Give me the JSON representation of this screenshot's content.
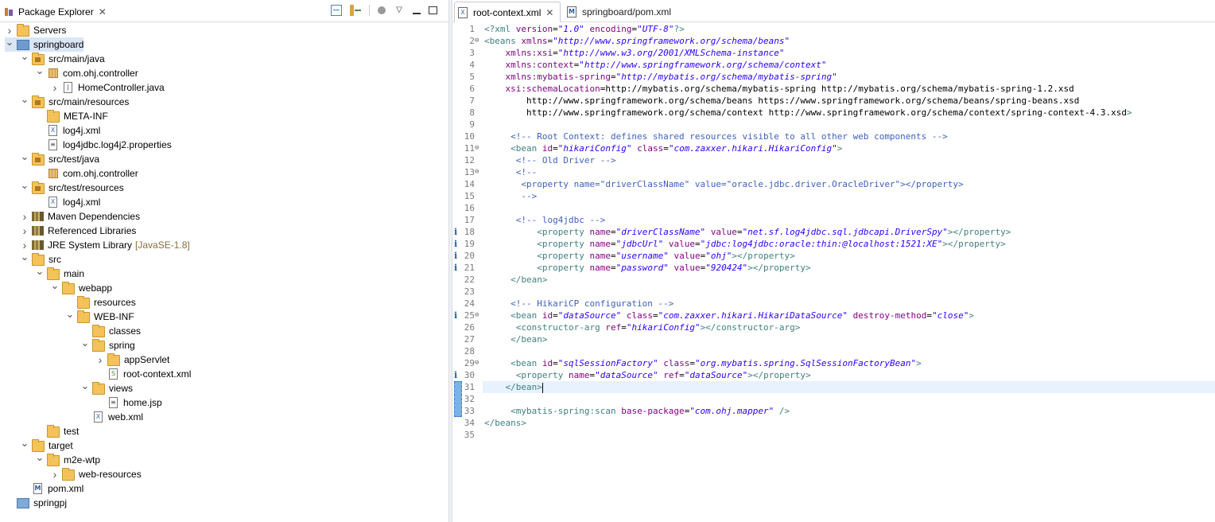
{
  "left_tab": {
    "title": "Package Explorer",
    "close": "✕"
  },
  "editor_tabs": [
    {
      "label": "root-context.xml",
      "close": "✕",
      "active": true
    },
    {
      "label": "springboard/pom.xml",
      "active": false
    }
  ],
  "tree": [
    {
      "label": "Servers",
      "depth": 0,
      "icon": "folder-icon",
      "expanded": false
    },
    {
      "label": "springboard",
      "depth": 0,
      "icon": "maven-project-icon",
      "expanded": true,
      "selected": true
    },
    {
      "label": "src/main/java",
      "depth": 1,
      "icon": "source-folder-icon",
      "expanded": true
    },
    {
      "label": "com.ohj.controller",
      "depth": 2,
      "icon": "package-icon",
      "expanded": true
    },
    {
      "label": "HomeController.java",
      "depth": 3,
      "icon": "java-file-icon",
      "expanded": false
    },
    {
      "label": "src/main/resources",
      "depth": 1,
      "icon": "source-folder-icon",
      "expanded": true
    },
    {
      "label": "META-INF",
      "depth": 2,
      "icon": "folder-icon",
      "expanded": null
    },
    {
      "label": "log4j.xml",
      "depth": 2,
      "icon": "xml-file-icon",
      "expanded": null
    },
    {
      "label": "log4jdbc.log4j2.properties",
      "depth": 2,
      "icon": "properties-file-icon",
      "expanded": null
    },
    {
      "label": "src/test/java",
      "depth": 1,
      "icon": "source-folder-icon",
      "expanded": true
    },
    {
      "label": "com.ohj.controller",
      "depth": 2,
      "icon": "package-icon",
      "expanded": null
    },
    {
      "label": "src/test/resources",
      "depth": 1,
      "icon": "source-folder-icon",
      "expanded": true
    },
    {
      "label": "log4j.xml",
      "depth": 2,
      "icon": "xml-file-icon",
      "expanded": null
    },
    {
      "label": "Maven Dependencies",
      "depth": 1,
      "icon": "library-icon",
      "expanded": false
    },
    {
      "label": "Referenced Libraries",
      "depth": 1,
      "icon": "library-icon",
      "expanded": false
    },
    {
      "label": "JRE System Library",
      "suffix": "[JavaSE-1.8]",
      "depth": 1,
      "icon": "library-icon",
      "expanded": false
    },
    {
      "label": "src",
      "depth": 1,
      "icon": "folder-icon",
      "expanded": true
    },
    {
      "label": "main",
      "depth": 2,
      "icon": "folder-icon",
      "expanded": true
    },
    {
      "label": "webapp",
      "depth": 3,
      "icon": "folder-icon",
      "expanded": true
    },
    {
      "label": "resources",
      "depth": 4,
      "icon": "folder-icon",
      "expanded": null
    },
    {
      "label": "WEB-INF",
      "depth": 4,
      "icon": "folder-icon",
      "expanded": true
    },
    {
      "label": "classes",
      "depth": 5,
      "icon": "folder-icon",
      "expanded": null
    },
    {
      "label": "spring",
      "depth": 5,
      "icon": "folder-icon",
      "expanded": true
    },
    {
      "label": "appServlet",
      "depth": 6,
      "icon": "folder-icon",
      "expanded": false
    },
    {
      "label": "root-context.xml",
      "depth": 6,
      "icon": "spring-xml-file-icon",
      "expanded": null
    },
    {
      "label": "views",
      "depth": 5,
      "icon": "folder-icon",
      "expanded": true
    },
    {
      "label": "home.jsp",
      "depth": 6,
      "icon": "jsp-file-icon",
      "expanded": null
    },
    {
      "label": "web.xml",
      "depth": 5,
      "icon": "xml-file-icon",
      "expanded": null
    },
    {
      "label": "test",
      "depth": 2,
      "icon": "folder-icon",
      "expanded": null
    },
    {
      "label": "target",
      "depth": 1,
      "icon": "folder-icon",
      "expanded": true
    },
    {
      "label": "m2e-wtp",
      "depth": 2,
      "icon": "folder-icon",
      "expanded": true
    },
    {
      "label": "web-resources",
      "depth": 3,
      "icon": "folder-icon",
      "expanded": false
    },
    {
      "label": "pom.xml",
      "depth": 1,
      "icon": "maven-file-icon",
      "expanded": null
    },
    {
      "label": "springpj",
      "depth": 0,
      "icon": "project-icon",
      "expanded": null
    }
  ],
  "code_lines": [
    "<?xml version=\"1.0\" encoding=\"UTF-8\"?>",
    "<beans xmlns=\"http://www.springframework.org/schema/beans\"",
    "    xmlns:xsi=\"http://www.w3.org/2001/XMLSchema-instance\"",
    "    xmlns:context=\"http://www.springframework.org/schema/context\"",
    "    xmlns:mybatis-spring=\"http://mybatis.org/schema/mybatis-spring\"",
    "    xsi:schemaLocation=\"http://mybatis.org/schema/mybatis-spring http://mybatis.org/schema/mybatis-spring-1.2.xsd",
    "        http://www.springframework.org/schema/beans https://www.springframework.org/schema/beans/spring-beans.xsd",
    "        http://www.springframework.org/schema/context http://www.springframework.org/schema/context/spring-context-4.3.xsd\">",
    "",
    "     <!-- Root Context: defines shared resources visible to all other web components -->",
    "     <bean id=\"hikariConfig\" class=\"com.zaxxer.hikari.HikariConfig\">",
    "      <!-- Old Driver -->",
    "      <!--",
    "       <property name=\"driverClassName\" value=\"oracle.jdbc.driver.OracleDriver\"></property>",
    "       -->",
    "",
    "      <!-- log4jdbc -->",
    "          <property name=\"driverClassName\" value=\"net.sf.log4jdbc.sql.jdbcapi.DriverSpy\"></property>",
    "          <property name=\"jdbcUrl\" value=\"jdbc:log4jdbc:oracle:thin:@localhost:1521:XE\"></property>",
    "          <property name=\"username\" value=\"ohj\"></property>",
    "          <property name=\"password\" value=\"920424\"></property>",
    "     </bean>",
    "",
    "     <!-- HikariCP configuration -->",
    "     <bean id=\"dataSource\" class=\"com.zaxxer.hikari.HikariDataSource\" destroy-method=\"close\">",
    "      <constructor-arg ref=\"hikariConfig\"></constructor-arg>",
    "     </bean>",
    "",
    "     <bean id=\"sqlSessionFactory\" class=\"org.mybatis.spring.SqlSessionFactoryBean\">",
    "      <property name=\"dataSource\" ref=\"dataSource\"></property>",
    "    </bean>",
    "",
    "     <mybatis-spring:scan base-package=\"com.ohj.mapper\" />",
    "</beans>",
    ""
  ],
  "info_marker_lines": [
    18,
    19,
    20,
    21,
    25,
    30
  ],
  "fold_lines": [
    2,
    11,
    13,
    25,
    29
  ],
  "current_line": 31,
  "info_marker": "i",
  "fold_marker": "⊖"
}
